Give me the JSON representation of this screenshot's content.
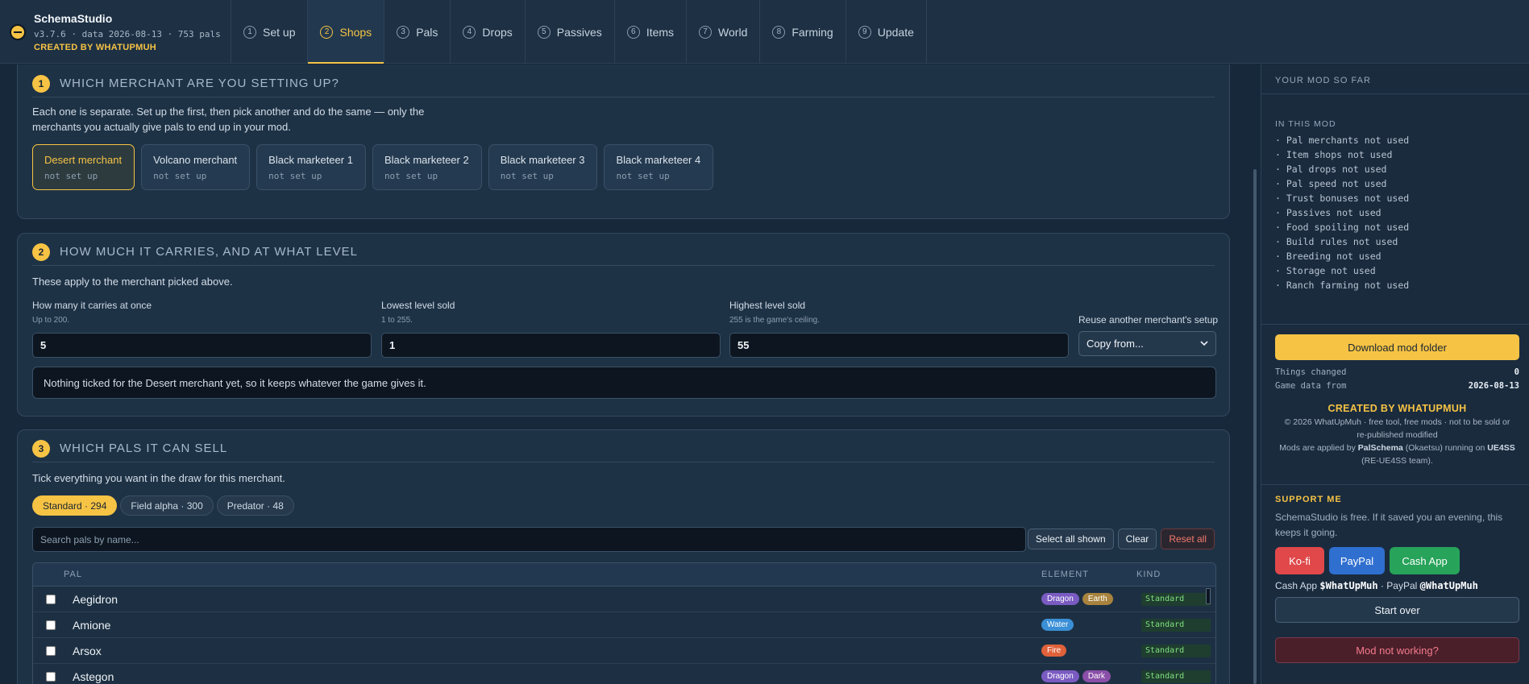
{
  "brand": {
    "title": "SchemaStudio",
    "version": "v3.7.6 · data 2026-08-13 · 753 pals",
    "created_by": "CREATED BY WHATUPMUH"
  },
  "tabs": [
    {
      "num": "1",
      "label": "Set up"
    },
    {
      "num": "2",
      "label": "Shops"
    },
    {
      "num": "3",
      "label": "Pals"
    },
    {
      "num": "4",
      "label": "Drops"
    },
    {
      "num": "5",
      "label": "Passives"
    },
    {
      "num": "6",
      "label": "Items"
    },
    {
      "num": "7",
      "label": "World"
    },
    {
      "num": "8",
      "label": "Farming"
    },
    {
      "num": "9",
      "label": "Update"
    }
  ],
  "active_tab": "Shops",
  "section1": {
    "num": "1",
    "title": "WHICH MERCHANT ARE YOU SETTING UP?",
    "desc_line1": "Each one is separate. Set up the first, then pick another and do the same — only the",
    "desc_line2": "merchants you actually give pals to end up in your mod.",
    "merchants": [
      {
        "name": "Desert merchant",
        "status": "not set up"
      },
      {
        "name": "Volcano merchant",
        "status": "not set up"
      },
      {
        "name": "Black marketeer 1",
        "status": "not set up"
      },
      {
        "name": "Black marketeer 2",
        "status": "not set up"
      },
      {
        "name": "Black marketeer 3",
        "status": "not set up"
      },
      {
        "name": "Black marketeer 4",
        "status": "not set up"
      }
    ]
  },
  "section2": {
    "num": "2",
    "title": "HOW MUCH IT CARRIES, AND AT WHAT LEVEL",
    "desc": "These apply to the merchant picked above.",
    "carry": {
      "label": "How many it carries at once",
      "hint": "Up to 200.",
      "value": "5"
    },
    "low": {
      "label": "Lowest level sold",
      "hint": "1 to 255.",
      "value": "1"
    },
    "high": {
      "label": "Highest level sold",
      "hint": "255 is the game's ceiling.",
      "value": "55"
    },
    "reuse": {
      "label": "Reuse another merchant's setup",
      "value": "Copy from..."
    },
    "note": "Nothing ticked for the Desert merchant yet, so it keeps whatever the game gives it."
  },
  "section3": {
    "num": "3",
    "title": "WHICH PALS IT CAN SELL",
    "desc": "Tick everything you want in the draw for this merchant.",
    "filters": [
      "Standard · 294",
      "Field alpha · 300",
      "Predator · 48"
    ],
    "search_placeholder": "Search pals by name...",
    "select_all": "Select all shown",
    "clear": "Clear",
    "reset_all": "Reset all",
    "columns": {
      "pal": "PAL",
      "element": "ELEMENT",
      "kind": "KIND"
    },
    "rows": [
      {
        "name": "Aegidron",
        "elements": [
          "Dragon",
          "Earth"
        ],
        "kind": "Standard"
      },
      {
        "name": "Amione",
        "elements": [
          "Water"
        ],
        "kind": "Standard"
      },
      {
        "name": "Arsox",
        "elements": [
          "Fire"
        ],
        "kind": "Standard"
      },
      {
        "name": "Astegon",
        "elements": [
          "Dragon",
          "Dark"
        ],
        "kind": "Standard"
      }
    ]
  },
  "element_colors": {
    "Dragon": "#7a5bc2",
    "Earth": "#a8833e",
    "Water": "#3a8fd6",
    "Fire": "#e0613a",
    "Dark": "#8a4fa8"
  },
  "sidebar": {
    "title": "YOUR MOD SO FAR",
    "in_this_mod": "IN THIS MOD",
    "items": [
      "· Pal merchants not used",
      "· Item shops not used",
      "· Pal drops not used",
      "· Pal speed not used",
      "· Trust bonuses not used",
      "· Passives not used",
      "· Food spoiling not used",
      "· Build rules not used",
      "· Breeding not used",
      "· Storage not used",
      "· Ranch farming not used"
    ],
    "download": "Download mod folder",
    "things_changed_label": "Things changed",
    "things_changed": "0",
    "game_data_label": "Game data from",
    "game_data": "2026-08-13",
    "created_by": "CREATED BY WHATUPMUH",
    "copyright1": "© 2026 WhatUpMuh · free tool, free mods · not to be sold or",
    "copyright2": "re-published modified",
    "applied_pre": "Mods are applied by ",
    "applied_palschema": "PalSchema",
    "applied_mid": " (Okaetsu) running on ",
    "applied_ue4ss": "UE4SS",
    "applied_post": "(RE-UE4SS team).",
    "support_title": "SUPPORT ME",
    "support_text1": "SchemaStudio is free. If it saved you an evening, this",
    "support_text2": "keeps it going.",
    "kofi": "Ko-fi",
    "paypal": "PayPal",
    "cashapp": "Cash App",
    "handles_cash_label": "Cash App ",
    "handles_cash": "$WhatUpMuh",
    "handles_mid": " · PayPal ",
    "handles_paypal": "@WhatUpMuh",
    "start_over": "Start over",
    "mod_not_working": "Mod not working?"
  }
}
